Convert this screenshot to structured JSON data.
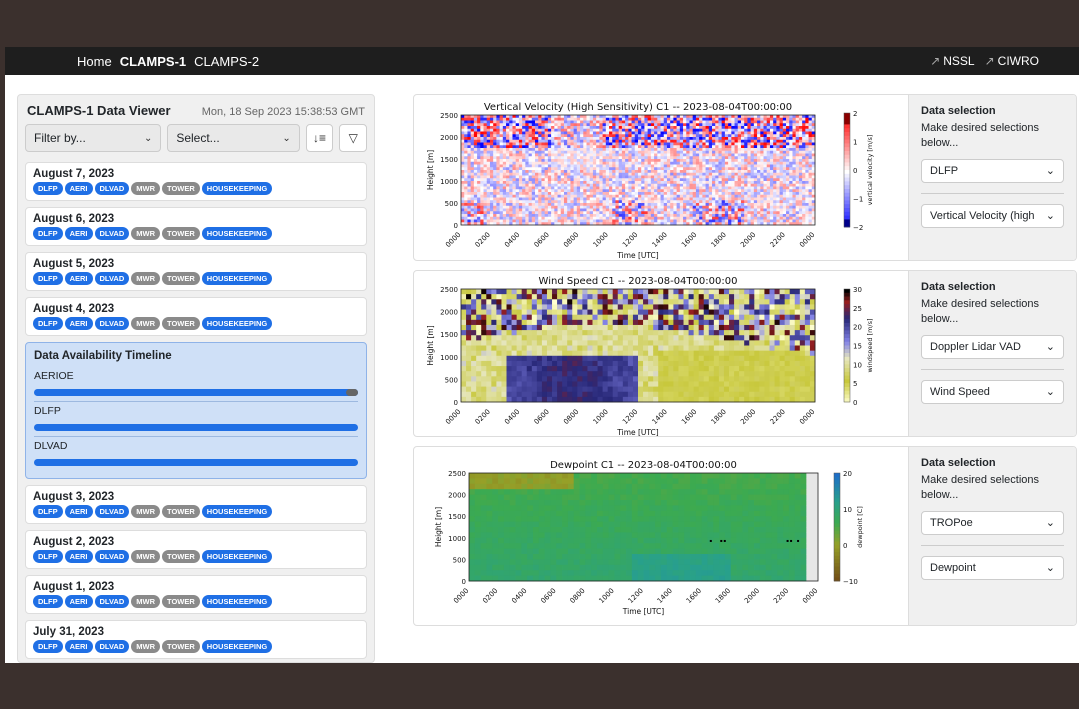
{
  "nav": {
    "home": "Home",
    "clamps1": "CLAMPS-1",
    "clamps2": "CLAMPS-2",
    "nssl": "NSSL",
    "ciwro": "CIWRO"
  },
  "sidebar": {
    "title": "CLAMPS-1 Data Viewer",
    "timestamp": "Mon, 18 Sep 2023 15:38:53 GMT",
    "filter_placeholder": "Filter by...",
    "select_placeholder": "Select...",
    "badge_labels": [
      "DLFP",
      "AERI",
      "DLVAD",
      "MWR",
      "TOWER",
      "HOUSEKEEPING"
    ],
    "dates_top": [
      "August 7, 2023",
      "August 6, 2023",
      "August 5, 2023",
      "August 4, 2023"
    ],
    "timeline": {
      "title": "Data Availability Timeline",
      "rows": [
        {
          "label": "AERIOE",
          "coverage": 0.96
        },
        {
          "label": "DLFP",
          "coverage": 1.0
        },
        {
          "label": "DLVAD",
          "coverage": 1.0
        }
      ]
    },
    "dates_bottom": [
      "August 3, 2023",
      "August 2, 2023",
      "August 1, 2023",
      "July 31, 2023"
    ]
  },
  "panels": [
    {
      "chart_title": "Vertical Velocity (High Sensitivity) C1 -- 2023-08-04T00:00:00",
      "ylabel": "Height [m]",
      "xlabel": "Time [UTC]",
      "cbar_label": "vertical velocity [m/s]",
      "yticks": [
        "2500",
        "2000",
        "1500",
        "1000",
        "500",
        "0"
      ],
      "cbar_ticks": [
        "2",
        "1",
        "0",
        "−1",
        "−2"
      ],
      "ds_title": "Data selection",
      "ds_text": "Make desired selections below...",
      "select1": "DLFP",
      "select2": "Vertical Velocity (high"
    },
    {
      "chart_title": "Wind Speed C1 -- 2023-08-04T00:00:00",
      "ylabel": "Height [m]",
      "xlabel": "Time [UTC]",
      "cbar_label": "windspeed [m/s]",
      "yticks": [
        "2500",
        "2000",
        "1500",
        "1000",
        "500",
        "0"
      ],
      "cbar_ticks": [
        "30",
        "25",
        "20",
        "15",
        "10",
        "5",
        "0"
      ],
      "ds_title": "Data selection",
      "ds_text": "Make desired selections below...",
      "select1": "Doppler Lidar VAD",
      "select2": "Wind Speed"
    },
    {
      "chart_title": "Dewpoint C1 -- 2023-08-04T00:00:00",
      "ylabel": "Height [m]",
      "xlabel": "Time [UTC]",
      "cbar_label": "dewpoint [C]",
      "yticks": [
        "2500",
        "2000",
        "1500",
        "1000",
        "500",
        "0"
      ],
      "cbar_ticks": [
        "20",
        "10",
        "0",
        "−10"
      ],
      "ds_title": "Data selection",
      "ds_text": "Make desired selections below...",
      "select1": "TROPoe",
      "select2": "Dewpoint"
    }
  ],
  "xticks": [
    "0000",
    "0200",
    "0400",
    "0600",
    "0800",
    "1000",
    "1200",
    "1400",
    "1600",
    "1800",
    "2000",
    "2200",
    "0000"
  ],
  "colors": {
    "accent": "#1f6fe5",
    "badge_off": "#8a8a8a",
    "navbar": "#1e1e1e",
    "backdrop": "#3b302d"
  }
}
